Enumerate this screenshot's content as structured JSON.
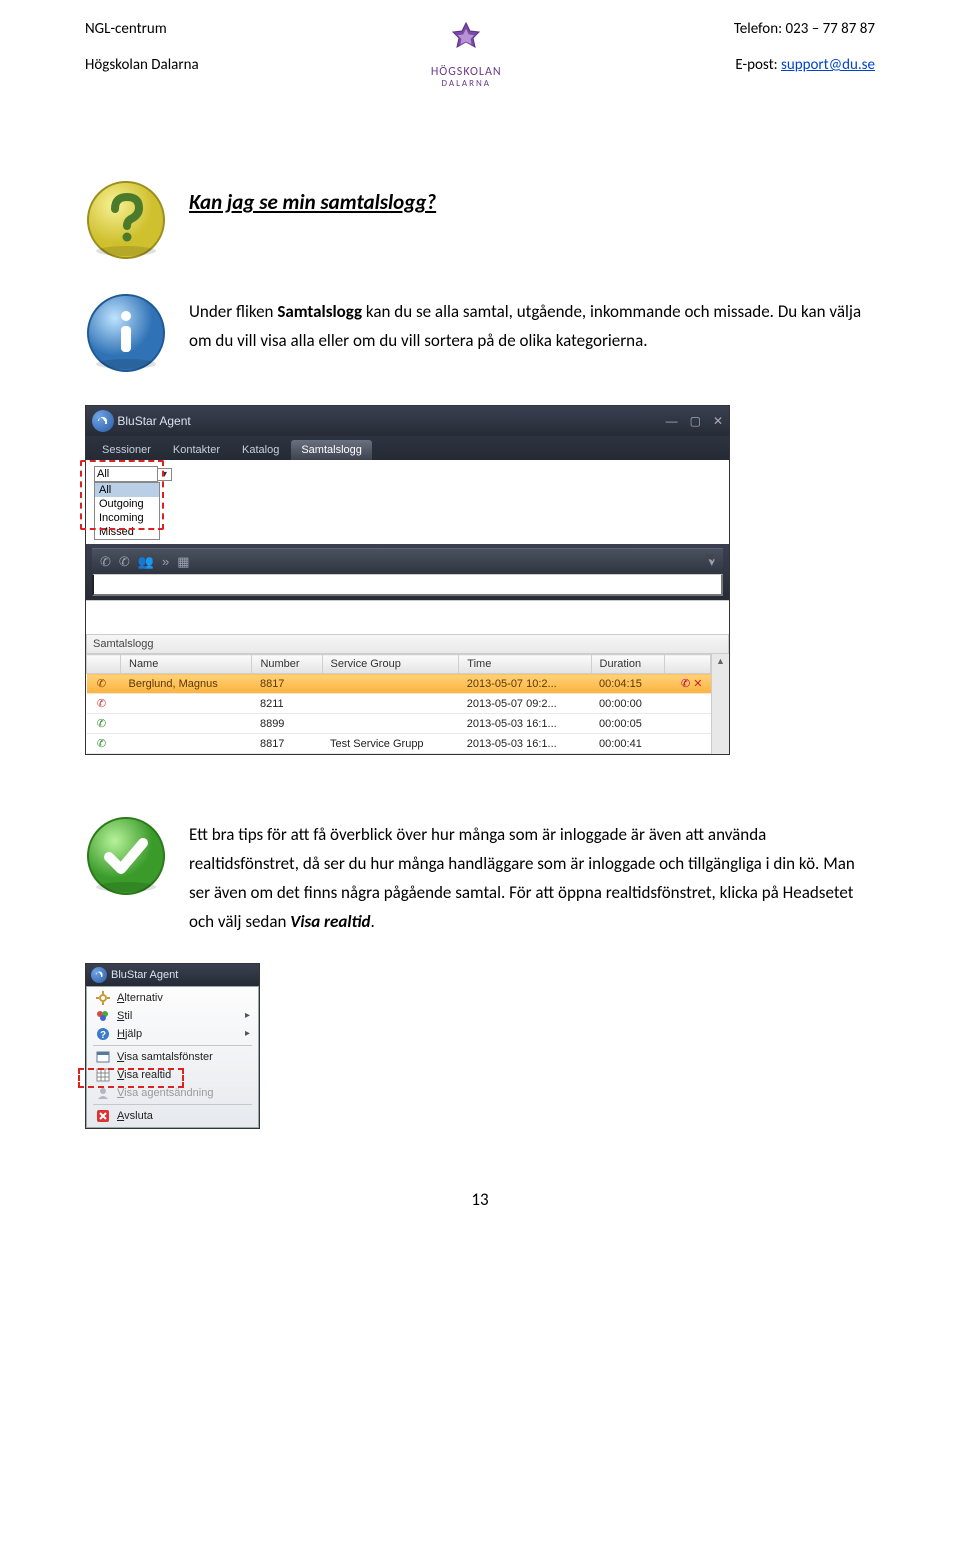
{
  "header": {
    "left1": "NGL-centrum",
    "left2": "Högskolan Dalarna",
    "right1_label": "Telefon: ",
    "right1_value": "023 – 77 87 87",
    "right2_label": "E-post: ",
    "right2_link": "support@du.se",
    "logo_line1": "HÖGSKOLAN",
    "logo_line2": "DALARNA"
  },
  "section_q": {
    "heading": "Kan jag se min samtalslogg?"
  },
  "section_i": {
    "p1a": "Under fliken ",
    "p1b": "Samtalslogg",
    "p1c": " kan du se alla samtal, utgående, inkommande och missade. Du kan välja om du vill visa alla eller om du vill sortera på de olika kategorierna."
  },
  "app1": {
    "title": "BluStar Agent",
    "tabs": [
      "Sessioner",
      "Kontakter",
      "Katalog",
      "Samtalslogg"
    ],
    "active_tab_index": 3,
    "filter_selected": "All",
    "filter_options": [
      "All",
      "Outgoing",
      "Incoming",
      "Missed"
    ],
    "section_title": "Samtalslogg",
    "columns": [
      "Name",
      "Number",
      "Service Group",
      "Time",
      "Duration"
    ],
    "rows": [
      {
        "icon": "missed",
        "name": "Berglund, Magnus",
        "number": "8817",
        "group": "",
        "time": "2013-05-07 10:2...",
        "duration": "00:04:15",
        "selected": true,
        "actions": true
      },
      {
        "icon": "missed",
        "name": "",
        "number": "8211",
        "group": "",
        "time": "2013-05-07 09:2...",
        "duration": "00:00:00"
      },
      {
        "icon": "outgoing",
        "name": "",
        "number": "8899",
        "group": "",
        "time": "2013-05-03 16:1...",
        "duration": "00:00:05"
      },
      {
        "icon": "outgoing",
        "name": "",
        "number": "8817",
        "group": "Test Service Grupp",
        "time": "2013-05-03 16:1...",
        "duration": "00:00:41"
      }
    ]
  },
  "section_t": {
    "p": "Ett bra tips för att få överblick över hur många som är inloggade är även att använda realtidsfönstret, då ser du hur många handläggare som är inloggade och tillgängliga i din kö. Man ser även om det finns några pågående samtal. För att öppna realtidsfönstret, klicka på Headsetet och välj sedan ",
    "p_bold": "Visa realtid",
    "p_end": "."
  },
  "app2": {
    "title": "BluStar Agent",
    "menu": [
      {
        "icon": "gear",
        "label": "Alternativ",
        "underline": "A"
      },
      {
        "icon": "palette",
        "label": "Stil",
        "underline": "S",
        "arrow": true
      },
      {
        "icon": "help",
        "label": "Hjälp",
        "underline": "H",
        "arrow": true
      },
      {
        "sep": true
      },
      {
        "icon": "window",
        "label": "Visa samtalsfönster",
        "underline": "V"
      },
      {
        "icon": "grid",
        "label": "Visa realtid",
        "underline": "V"
      },
      {
        "icon": "agent",
        "label": "Visa agentsändning",
        "underline": "V",
        "disabled": true
      },
      {
        "sep": true
      },
      {
        "icon": "close",
        "label": "Avsluta",
        "underline": "A"
      }
    ]
  },
  "page_number": "13"
}
